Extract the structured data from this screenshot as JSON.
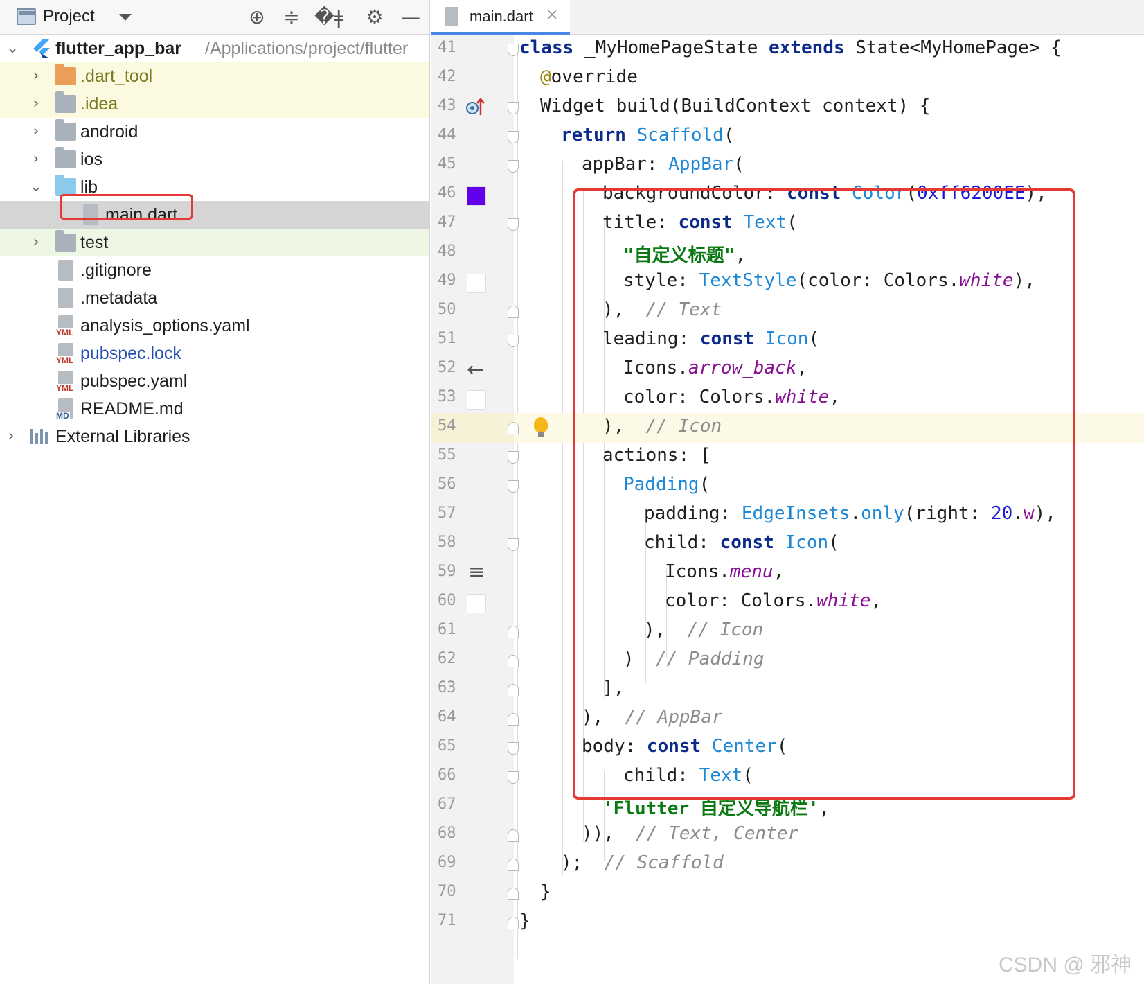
{
  "project_panel": {
    "title": "Project",
    "tree": [
      {
        "label": "flutter_app_bar",
        "path": "/Applications/project/flutter",
        "type": "project"
      },
      {
        "label": ".dart_tool",
        "type": "folder-orange"
      },
      {
        "label": ".idea",
        "type": "folder-gray"
      },
      {
        "label": "android",
        "type": "folder-gray"
      },
      {
        "label": "ios",
        "type": "folder-gray"
      },
      {
        "label": "lib",
        "type": "folder-blue"
      },
      {
        "label": "main.dart",
        "type": "dart-file"
      },
      {
        "label": "test",
        "type": "folder-gray"
      },
      {
        "label": ".gitignore",
        "type": "file"
      },
      {
        "label": ".metadata",
        "type": "file"
      },
      {
        "label": "analysis_options.yaml",
        "type": "yaml",
        "badge": "YML"
      },
      {
        "label": "pubspec.lock",
        "type": "yaml",
        "badge": "YML"
      },
      {
        "label": "pubspec.yaml",
        "type": "yaml",
        "badge": "YML"
      },
      {
        "label": "README.md",
        "type": "md",
        "badge": "MD"
      },
      {
        "label": "External Libraries",
        "type": "libraries"
      }
    ]
  },
  "editor": {
    "tab_label": "main.dart",
    "tab_close": "×",
    "swatch_colors": {
      "purple": "#6200EE",
      "white": "#FFFFFF"
    },
    "line_numbers": [
      "41",
      "42",
      "43",
      "44",
      "45",
      "46",
      "47",
      "48",
      "49",
      "50",
      "51",
      "52",
      "53",
      "54",
      "55",
      "56",
      "57",
      "58",
      "59",
      "60",
      "61",
      "62",
      "63",
      "64",
      "65",
      "66",
      "67",
      "68",
      "69",
      "70",
      "71"
    ],
    "current_line": "54"
  },
  "watermark": "CSDN @ 邪神"
}
